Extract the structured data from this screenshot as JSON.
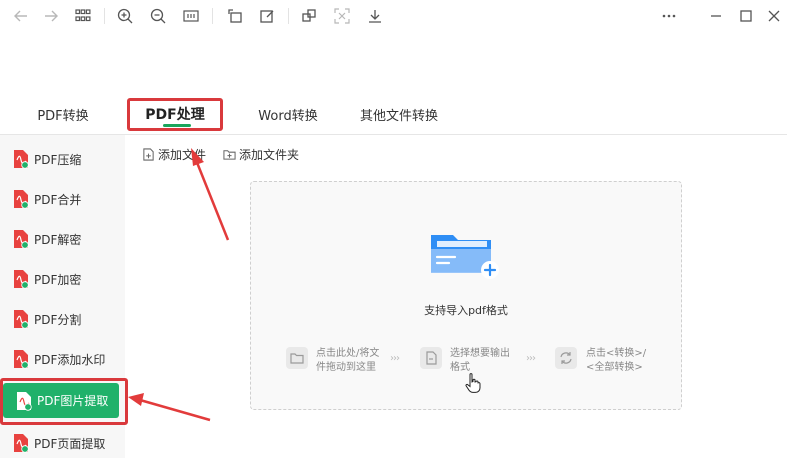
{
  "toolbar": {
    "icons": [
      "back-icon",
      "forward-icon",
      "grid-icon",
      "zoom-in-icon",
      "zoom-out-icon",
      "fit-page-icon",
      "rotate-icon",
      "edit-icon",
      "crop-icon",
      "screenshot-icon",
      "download-icon",
      "more-icon",
      "minimize-icon",
      "maximize-icon",
      "close-icon"
    ]
  },
  "tabs": [
    {
      "label": "PDF转换"
    },
    {
      "label": "PDF处理"
    },
    {
      "label": "Word转换"
    },
    {
      "label": "其他文件转换"
    }
  ],
  "sidebar": {
    "items": [
      {
        "label": "PDF压缩"
      },
      {
        "label": "PDF合并"
      },
      {
        "label": "PDF解密"
      },
      {
        "label": "PDF加密"
      },
      {
        "label": "PDF分割"
      },
      {
        "label": "PDF添加水印"
      },
      {
        "label": "PDF图片提取"
      },
      {
        "label": "PDF页面提取"
      }
    ],
    "active_index": 6
  },
  "file_actions": {
    "add_file": "添加文件",
    "add_folder": "添加文件夹"
  },
  "dropzone": {
    "title": "支持导入pdf格式",
    "steps": [
      {
        "line1": "点击此处/将文",
        "line2": "件拖动到这里"
      },
      {
        "line1": "选择想要输出",
        "line2": "格式"
      },
      {
        "line1": "点击<转换>/",
        "line2": "<全部转换>"
      }
    ],
    "arrow": "›››"
  },
  "colors": {
    "accent_green": "#20b16a",
    "highlight_red": "#d9393c",
    "folder_blue": "#2f8ef5"
  }
}
